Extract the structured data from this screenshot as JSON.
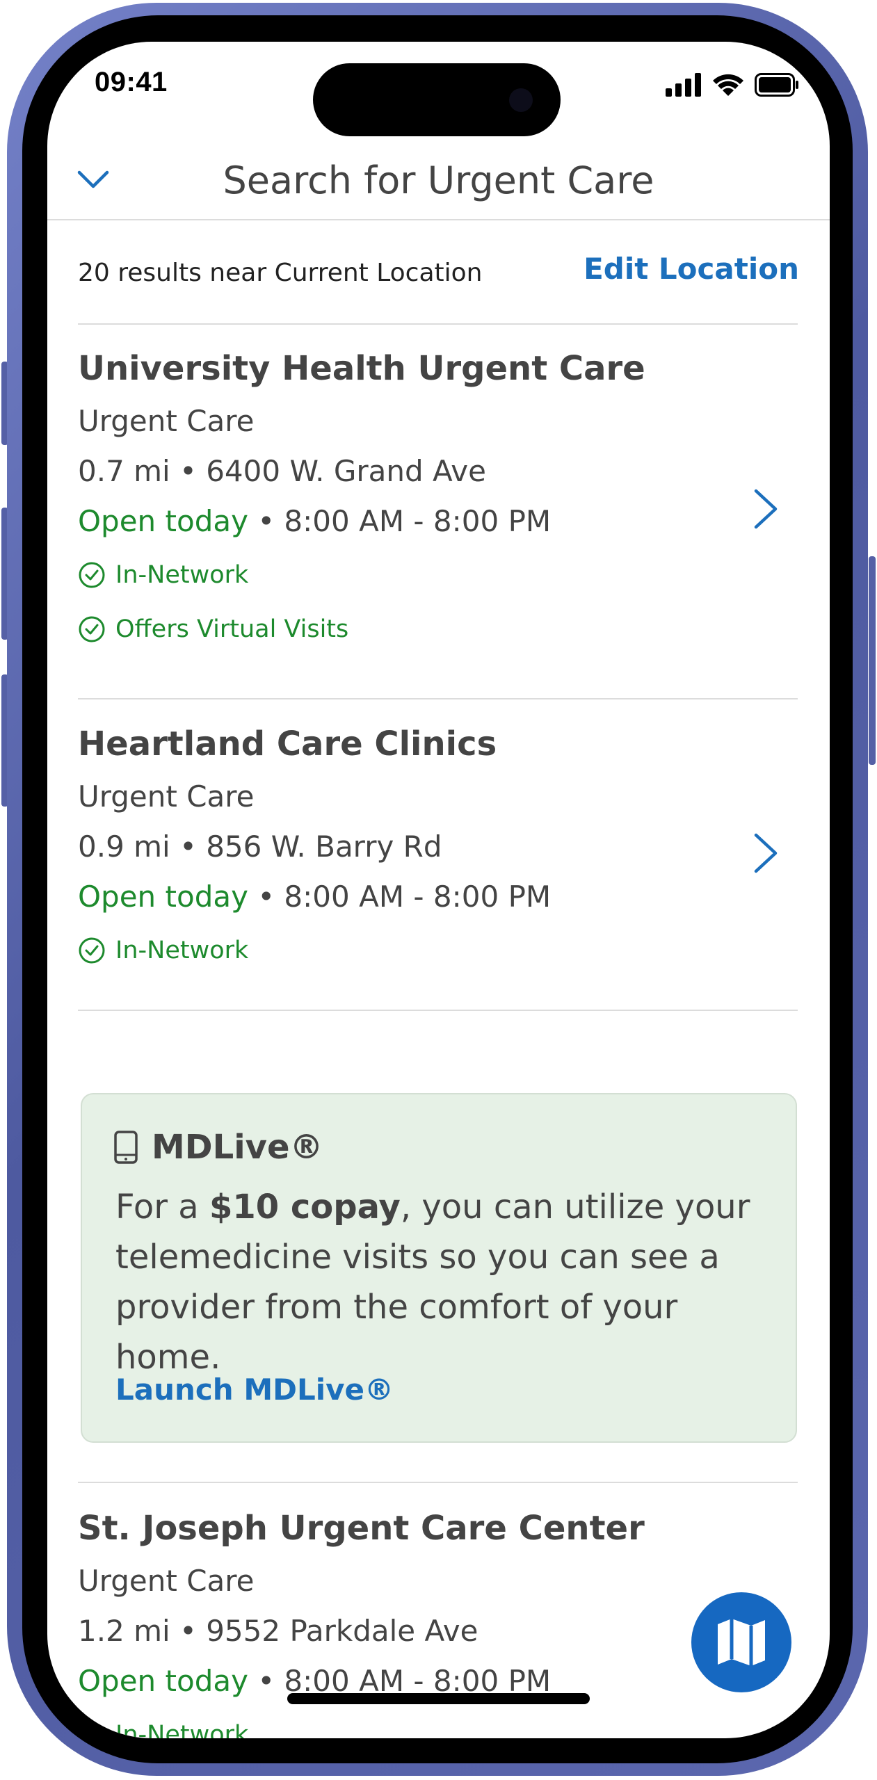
{
  "status_bar": {
    "time": "09:41"
  },
  "nav": {
    "title": "Search for Urgent Care"
  },
  "results": {
    "count_text": "20 results near Current Location",
    "edit_location": "Edit Location"
  },
  "providers": [
    {
      "name": "University Health Urgent Care",
      "type": "Urgent Care",
      "distance_address": "0.7 mi • 6400 W. Grand Ave",
      "open_status": "Open today",
      "hours": "• 8:00 AM - 8:00 PM",
      "badges": [
        "In-Network",
        "Offers Virtual Visits"
      ]
    },
    {
      "name": "Heartland Care Clinics",
      "type": "Urgent Care",
      "distance_address": "0.9 mi • 856 W. Barry Rd",
      "open_status": "Open today",
      "hours": "• 8:00 AM - 8:00 PM",
      "badges": [
        "In-Network"
      ]
    },
    {
      "name": "St. Joseph Urgent Care Center",
      "type": "Urgent Care",
      "distance_address": "1.2 mi • 9552 Parkdale Ave",
      "open_status": "Open today",
      "hours": "• 8:00 AM - 8:00 PM",
      "badges": [
        "In-Network"
      ]
    }
  ],
  "mdlive": {
    "title": "MDLive®",
    "body_prefix": "For a ",
    "body_bold": "$10 copay",
    "body_suffix": ", you can utilize your telemedicine visits so you can see a provider from the comfort of your home.",
    "launch_label": "Launch MDLive®"
  },
  "colors": {
    "accent_blue": "#1c6fbc",
    "open_green": "#1d8a2d",
    "mdlive_bg": "#e6f1e6",
    "frame": "#5b67ae"
  },
  "icons": {
    "back": "chevron-down-icon",
    "row_action": "chevron-right-icon",
    "badge": "check-circle-icon",
    "mdlive": "phone-device-icon",
    "fab": "map-icon"
  }
}
